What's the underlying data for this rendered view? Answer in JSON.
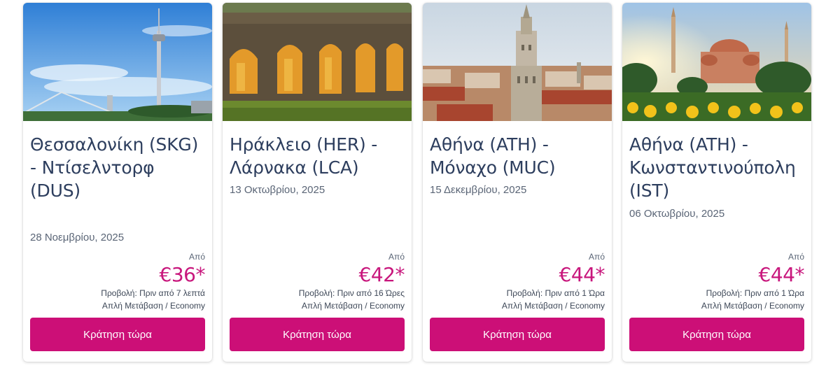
{
  "price_from_label": "Από",
  "deals": [
    {
      "route": "Θεσσαλονίκη (SKG) - Ντίσελντορφ (DUS)",
      "date": "28 Νοεμβρίου, 2025",
      "price": "€36*",
      "viewed": "Προβολή: Πριν από 7 λεπτά",
      "trip": "Απλή Μετάβαση  /  Economy",
      "cta": "Κράτηση τώρα"
    },
    {
      "route": "Ηράκλειο (HER) - Λάρνακα (LCA)",
      "date": "13 Οκτωβρίου, 2025",
      "price": "€42*",
      "viewed": "Προβολή: Πριν από 16 Ώρες",
      "trip": "Απλή Μετάβαση  /  Economy",
      "cta": "Κράτηση τώρα"
    },
    {
      "route": "Αθήνα (ATH) - Μόναχο (MUC)",
      "date": "15 Δεκεμβρίου, 2025",
      "price": "€44*",
      "viewed": "Προβολή: Πριν από 1 Ώρα",
      "trip": "Απλή Μετάβαση  /  Economy",
      "cta": "Κράτηση τώρα"
    },
    {
      "route": "Αθήνα (ATH) - Κωνσταντινούπολη (IST)",
      "date": "06 Οκτωβρίου, 2025",
      "price": "€44*",
      "viewed": "Προβολή: Πριν από 1 Ώρα",
      "trip": "Απλή Μετάβαση  /  Economy",
      "cta": "Κράτηση τώρα"
    }
  ],
  "colors": {
    "accent": "#cc0f77",
    "price": "#c8167c",
    "title": "#2d3e5e"
  }
}
